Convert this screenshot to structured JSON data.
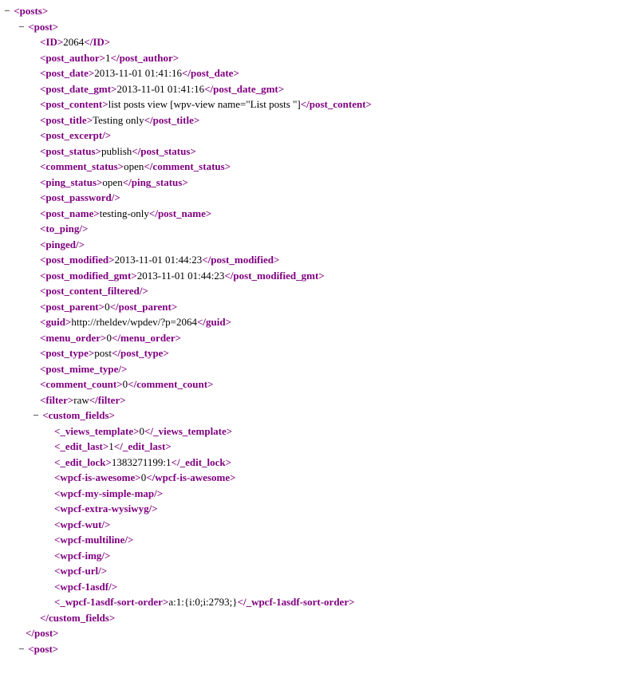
{
  "toggle": "−",
  "tags": {
    "posts": "posts",
    "post": "post",
    "ID": "ID",
    "post_author": "post_author",
    "post_date": "post_date",
    "post_date_gmt": "post_date_gmt",
    "post_content": "post_content",
    "post_title": "post_title",
    "post_excerpt": "post_excerpt",
    "post_status": "post_status",
    "comment_status": "comment_status",
    "ping_status": "ping_status",
    "post_password": "post_password",
    "post_name": "post_name",
    "to_ping": "to_ping",
    "pinged": "pinged",
    "post_modified": "post_modified",
    "post_modified_gmt": "post_modified_gmt",
    "post_content_filtered": "post_content_filtered",
    "post_parent": "post_parent",
    "guid": "guid",
    "menu_order": "menu_order",
    "post_type": "post_type",
    "post_mime_type": "post_mime_type",
    "comment_count": "comment_count",
    "filter": "filter",
    "custom_fields": "custom_fields",
    "_views_template": "_views_template",
    "_edit_last": "_edit_last",
    "_edit_lock": "_edit_lock",
    "wpcf_is_awesome": "wpcf-is-awesome",
    "wpcf_my_simple_map": "wpcf-my-simple-map",
    "wpcf_extra_wysiwyg": "wpcf-extra-wysiwyg",
    "wpcf_wut": "wpcf-wut",
    "wpcf_multiline": "wpcf-multiline",
    "wpcf_img": "wpcf-img",
    "wpcf_url": "wpcf-url",
    "wpcf_1asdf": "wpcf-1asdf",
    "_wpcf_1asdf_sort_order": "_wpcf-1asdf-sort-order"
  },
  "vals": {
    "ID": "2064",
    "post_author": "1",
    "post_date": "2013-11-01 01:41:16",
    "post_date_gmt": "2013-11-01 01:41:16",
    "post_content": "list posts view [wpv-view name=\"List posts \"]",
    "post_title": "Testing only",
    "post_status": "publish",
    "comment_status": "open",
    "ping_status": "open",
    "post_name": "testing-only",
    "post_modified": "2013-11-01 01:44:23",
    "post_modified_gmt": "2013-11-01 01:44:23",
    "post_parent": "0",
    "guid": "http://rheldev/wpdev/?p=2064",
    "menu_order": "0",
    "post_type": "post",
    "comment_count": "0",
    "filter": "raw",
    "_views_template": "0",
    "_edit_last": "1",
    "_edit_lock": "1383271199:1",
    "wpcf_is_awesome": "0",
    "_wpcf_1asdf_sort_order": "a:1:{i:0;i:2793;}"
  }
}
